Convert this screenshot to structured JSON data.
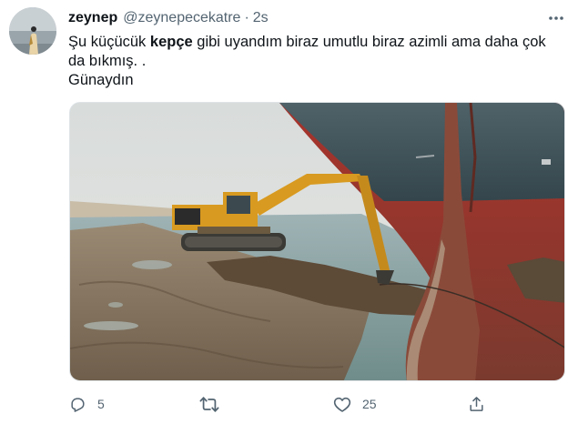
{
  "tweet": {
    "author": {
      "display_name": "zeynep",
      "handle": "@zeynepecekatre",
      "separator": "·",
      "time": "2s"
    },
    "text": {
      "line1_pre": "Şu küçücük ",
      "line1_bold": "kepçe",
      "line1_post": " gibi uyandım biraz umutlu biraz azimli ama daha çok da bıkmış. .",
      "line2": "Günaydın"
    },
    "media": {
      "icon": "photo"
    },
    "actions": {
      "reply": {
        "icon": "reply-icon",
        "count": "5"
      },
      "retweet": {
        "icon": "retweet-icon",
        "count": ""
      },
      "like": {
        "icon": "heart-icon",
        "count": "25"
      },
      "share": {
        "icon": "share-icon",
        "count": ""
      }
    }
  },
  "colors": {
    "text_primary": "#0f1419",
    "text_secondary": "#536471",
    "ship_hull_top": "#3d4f56",
    "ship_hull_red": "#a8332c",
    "excavator_yellow": "#d89a20"
  }
}
